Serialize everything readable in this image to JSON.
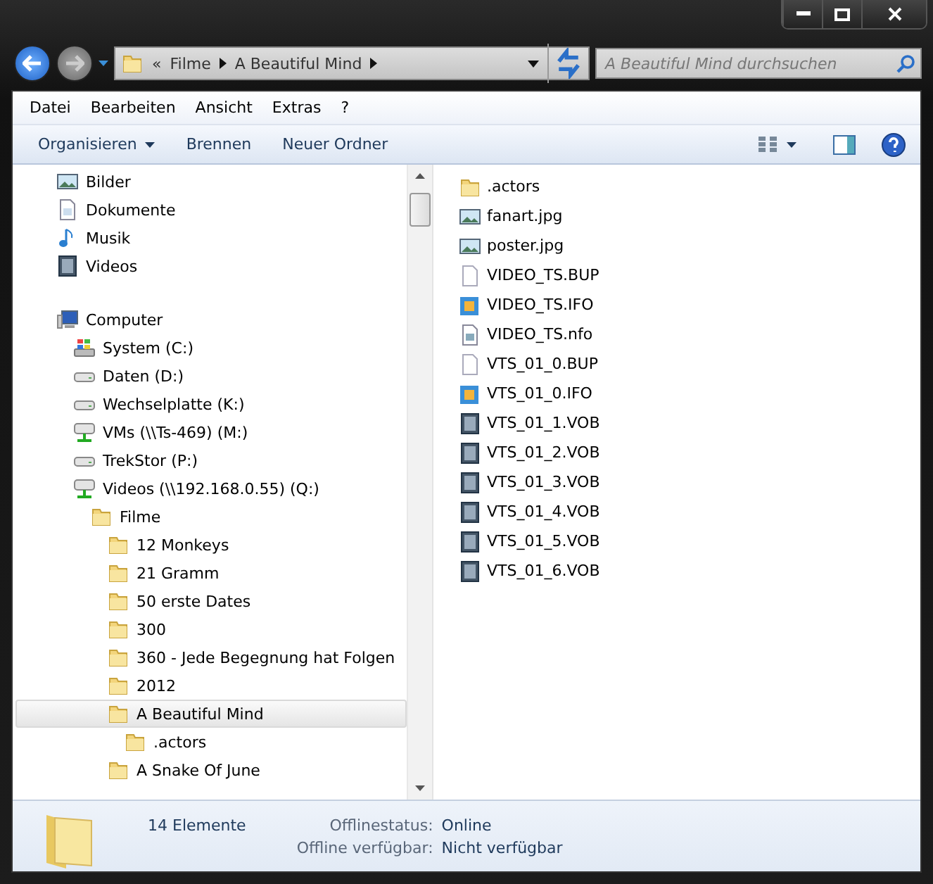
{
  "address": {
    "overflow": "«",
    "crumbs": [
      "Filme",
      "A Beautiful Mind"
    ]
  },
  "search": {
    "placeholder": "A Beautiful Mind durchsuchen"
  },
  "menu": [
    "Datei",
    "Bearbeiten",
    "Ansicht",
    "Extras",
    "?"
  ],
  "commands": [
    {
      "label": "Organisieren",
      "dropdown": true
    },
    {
      "label": "Brennen",
      "dropdown": false
    },
    {
      "label": "Neuer Ordner",
      "dropdown": false
    }
  ],
  "nav": [
    {
      "label": "Bilder",
      "kind": "pictures",
      "selected": false
    },
    {
      "label": "Dokumente",
      "kind": "documents",
      "selected": false
    },
    {
      "label": "Musik",
      "kind": "music",
      "selected": false
    },
    {
      "label": "Videos",
      "kind": "videos",
      "selected": false
    },
    {
      "kind": "spacer"
    },
    {
      "label": "Computer",
      "kind": "computer",
      "selected": false,
      "children": [
        {
          "label": "System (C:)",
          "kind": "system",
          "selected": false
        },
        {
          "label": "Daten (D:)",
          "kind": "drive",
          "selected": false
        },
        {
          "label": "Wechselplatte (K:)",
          "kind": "drive",
          "selected": false
        },
        {
          "label": "VMs (\\\\Ts-469) (M:)",
          "kind": "network",
          "selected": false
        },
        {
          "label": "TrekStor (P:)",
          "kind": "drive",
          "selected": false
        },
        {
          "label": "Videos (\\\\192.168.0.55) (Q:)",
          "kind": "network",
          "selected": false,
          "children": [
            {
              "label": "Filme",
              "kind": "folder",
              "selected": false,
              "children": [
                {
                  "label": "12 Monkeys",
                  "kind": "folder",
                  "selected": false
                },
                {
                  "label": "21 Gramm",
                  "kind": "folder",
                  "selected": false
                },
                {
                  "label": "50 erste Dates",
                  "kind": "folder",
                  "selected": false
                },
                {
                  "label": "300",
                  "kind": "folder",
                  "selected": false
                },
                {
                  "label": "360 - Jede Begegnung hat Folgen",
                  "kind": "folder",
                  "selected": false
                },
                {
                  "label": "2012",
                  "kind": "folder",
                  "selected": false
                },
                {
                  "label": "A Beautiful Mind",
                  "kind": "folder",
                  "selected": true,
                  "children": [
                    {
                      "label": ".actors",
                      "kind": "folder",
                      "selected": false
                    }
                  ]
                },
                {
                  "label": "A Snake Of June",
                  "kind": "folder",
                  "selected": false
                }
              ]
            }
          ]
        }
      ]
    }
  ],
  "files": [
    {
      "name": ".actors",
      "kind": "folder"
    },
    {
      "name": "fanart.jpg",
      "kind": "image"
    },
    {
      "name": "poster.jpg",
      "kind": "image"
    },
    {
      "name": "VIDEO_TS.BUP",
      "kind": "file"
    },
    {
      "name": "VIDEO_TS.IFO",
      "kind": "media"
    },
    {
      "name": "VIDEO_TS.nfo",
      "kind": "text"
    },
    {
      "name": "VTS_01_0.BUP",
      "kind": "file"
    },
    {
      "name": "VTS_01_0.IFO",
      "kind": "media"
    },
    {
      "name": "VTS_01_1.VOB",
      "kind": "video"
    },
    {
      "name": "VTS_01_2.VOB",
      "kind": "video"
    },
    {
      "name": "VTS_01_3.VOB",
      "kind": "video"
    },
    {
      "name": "VTS_01_4.VOB",
      "kind": "video"
    },
    {
      "name": "VTS_01_5.VOB",
      "kind": "video"
    },
    {
      "name": "VTS_01_6.VOB",
      "kind": "video"
    }
  ],
  "details": {
    "count": "14 Elemente",
    "fields": [
      {
        "label": "Offlinestatus:",
        "value": "Online"
      },
      {
        "label": "Offline verfügbar:",
        "value": "Nicht verfügbar"
      }
    ]
  }
}
